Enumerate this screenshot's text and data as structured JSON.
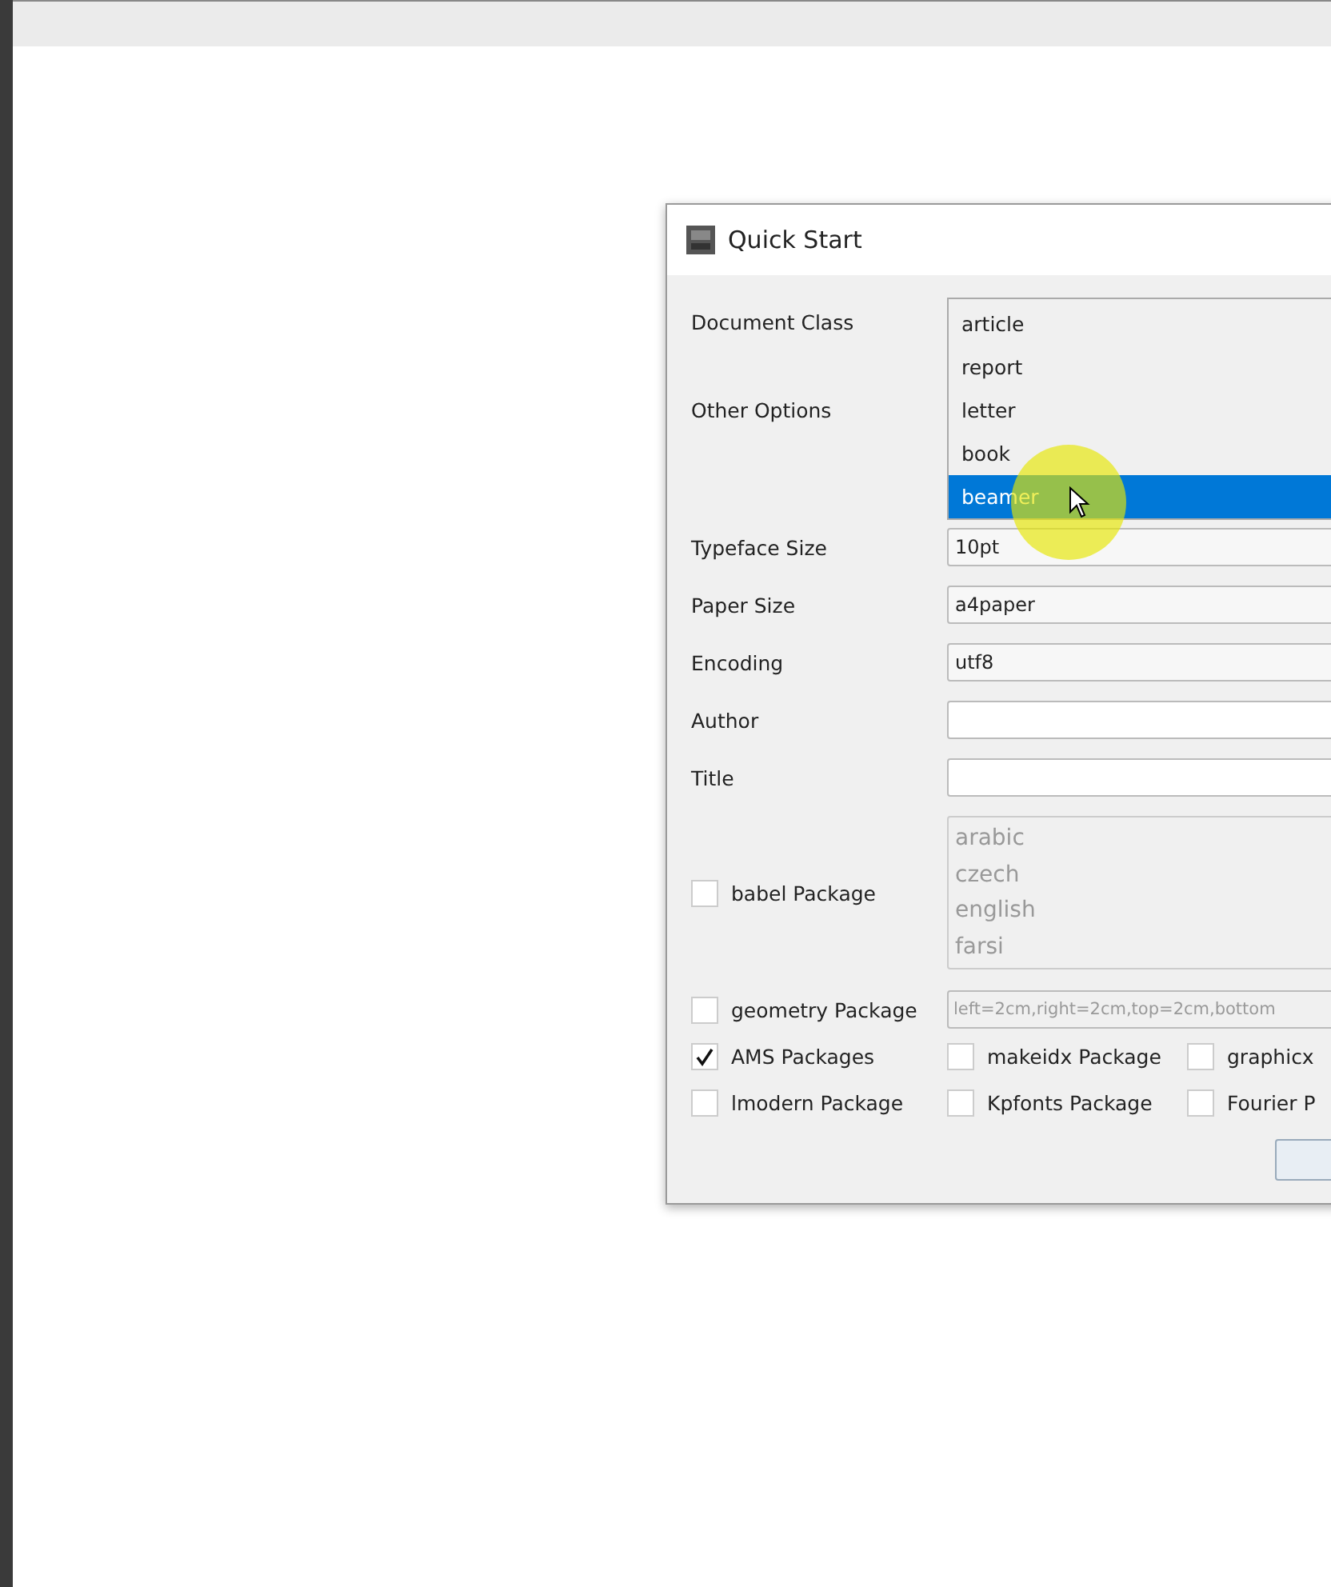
{
  "dialog": {
    "title": "Quick Start",
    "document_class": {
      "label": "Document Class",
      "options": [
        {
          "label": "article",
          "selected": false
        },
        {
          "label": "report",
          "selected": false
        },
        {
          "label": "letter",
          "selected": false
        },
        {
          "label": "book",
          "selected": false
        },
        {
          "label": "beamer",
          "selected": true
        }
      ]
    },
    "other_options": {
      "label": "Other Options"
    },
    "fields": [
      {
        "label": "Typeface Size",
        "kind": "combo",
        "value": "10pt"
      },
      {
        "label": "Paper Size",
        "kind": "combo",
        "value": "a4paper"
      },
      {
        "label": "Encoding",
        "kind": "combo",
        "value": "utf8"
      },
      {
        "label": "Author",
        "kind": "text"
      },
      {
        "label": "Title",
        "kind": "text"
      }
    ],
    "babel": {
      "label": "babel Package",
      "checked": false,
      "disabled": true,
      "languages": [
        "arabic",
        "czech",
        "english",
        "farsi"
      ]
    },
    "geometry": {
      "label": "geometry Package",
      "checked": false,
      "disabled": true,
      "value": "left=2cm,right=2cm,top=2cm,bottom"
    },
    "packages": [
      {
        "label": "AMS Packages",
        "checked": true
      },
      {
        "label": "makeidx Package",
        "checked": false
      },
      {
        "label": "graphicx",
        "checked": false
      },
      {
        "label": "lmodern Package",
        "checked": false
      },
      {
        "label": "Kpfonts Package",
        "checked": false
      },
      {
        "label": "Fourier P",
        "checked": false
      }
    ]
  }
}
